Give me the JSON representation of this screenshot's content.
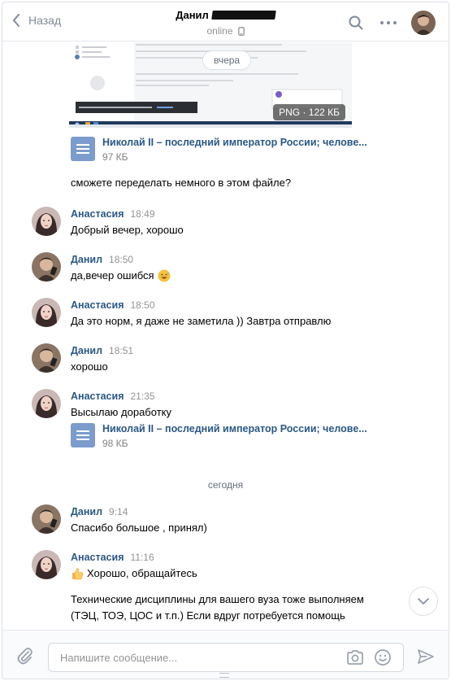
{
  "header": {
    "back_label": "Назад",
    "contact_name": "Данил",
    "status": "online"
  },
  "attachment_image": {
    "badge": "PNG · 122 КБ",
    "snippet_toast": "Некоторые разрешения браузера будут отключены",
    "snippet_menu": [
      "Отправленные",
      "Черновики"
    ]
  },
  "day_pill_top": "вчера",
  "doc1": {
    "name": "Николай II – последний император России; челове...",
    "size": "97 КБ"
  },
  "plain_text_1": "сможете переделать немного в этом файле?",
  "messages": [
    {
      "author": "Анастасия",
      "time": "18:49",
      "text": "Добрый вечер, хорошо"
    },
    {
      "author": "Данил",
      "time": "18:50",
      "text": "да,вечер ошибся"
    },
    {
      "author": "Анастасия",
      "time": "18:50",
      "text": "Да это норм, я даже не заметила )) Завтра отправлю"
    },
    {
      "author": "Данил",
      "time": "18:51",
      "text": "хорошо"
    },
    {
      "author": "Анастасия",
      "time": "21:35",
      "text": "Высылаю доработку"
    },
    {
      "author": "Данил",
      "time": "9:14",
      "text": "Спасибо большое , принял)"
    },
    {
      "author": "Анастасия",
      "time": "11:16",
      "text": "Хорошо, обращайтесь"
    }
  ],
  "doc2": {
    "name": "Николай II – последний император России; челове...",
    "size": "98 КБ"
  },
  "day_separator": "сегодня",
  "plain_text_2": {
    "line1": "Технические дисциплины для вашего вуза тоже выполняем",
    "line2": "(ТЭЦ, ТОЭ, ЦОС и т.п.) Если вдруг потребуется помощь"
  },
  "composer": {
    "placeholder": "Напишите сообщение..."
  },
  "colors": {
    "link": "#2a5885",
    "muted": "#939393",
    "doc_icon": "#7b9ccc"
  }
}
